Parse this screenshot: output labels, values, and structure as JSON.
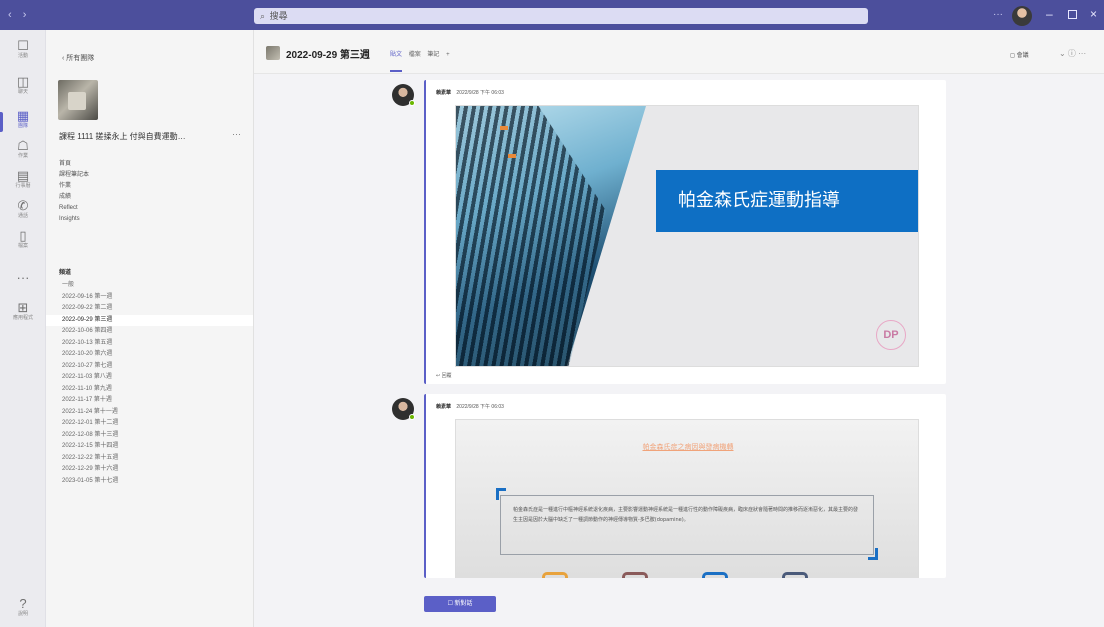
{
  "titlebar": {
    "search_placeholder": "搜尋",
    "nav_arrows": "‹ ›",
    "more": "···",
    "minimize": "–",
    "close": "×"
  },
  "rail": {
    "items": [
      {
        "label": "活動",
        "icon": "bell-icon",
        "glyph": "☐"
      },
      {
        "label": "聊天",
        "icon": "chat-icon",
        "glyph": "◫"
      },
      {
        "label": "團隊",
        "icon": "teams-icon",
        "glyph": "▦"
      },
      {
        "label": "作業",
        "icon": "assignments-icon",
        "glyph": "☖"
      },
      {
        "label": "行事曆",
        "icon": "calendar-icon",
        "glyph": "▤"
      },
      {
        "label": "通話",
        "icon": "phone-icon",
        "glyph": "✆"
      },
      {
        "label": "檔案",
        "icon": "files-icon",
        "glyph": "▯"
      },
      {
        "label": "",
        "icon": "more-apps-icon",
        "glyph": "···"
      },
      {
        "label": "應用程式",
        "icon": "apps-icon",
        "glyph": "⊞"
      },
      {
        "label": "說明",
        "icon": "help-icon",
        "glyph": "?"
      }
    ]
  },
  "team": {
    "back_label": "‹ 所有團隊",
    "name": "課程 1111 搓揉永上 付與自費運動…",
    "more": "···",
    "tabs": [
      "首頁",
      "課程筆記本",
      "作業",
      "成績",
      "Reflect",
      "Insights"
    ],
    "channels_title": "頻道",
    "channels": [
      "一般",
      "2022-09-16 第一週",
      "2022-09-22 第二週",
      "2022-09-29 第三週",
      "2022-10-06 第四週",
      "2022-10-13 第五週",
      "2022-10-20 第六週",
      "2022-10-27 第七週",
      "2022-11-03 第八週",
      "2022-11-10 第九週",
      "2022-11-17 第十週",
      "2022-11-24 第十一週",
      "2022-12-01 第十二週",
      "2022-12-08 第十三週",
      "2022-12-15 第十四週",
      "2022-12-22 第十五週",
      "2022-12-29 第十六週",
      "2023-01-05 第十七週"
    ],
    "selected_channel_index": 3
  },
  "channel": {
    "title": "2022-09-29 第三週",
    "tabs": [
      "貼文",
      "檔案",
      "筆記",
      "+"
    ],
    "active_tab": 0,
    "meet_label": "◻ 會議",
    "header_more": "⌄ ⓘ ···"
  },
  "messages": [
    {
      "author": "賴素華",
      "time": "2022/9/28 下午 06:03",
      "slide_title": "帕金森氏症運動指導",
      "slide_logo": "DP",
      "footer": "↩ 回覆"
    },
    {
      "author": "賴素華",
      "time": "2022/9/28 下午 06:03",
      "slide_title": "帕金森氏症之病因與發病機轉",
      "slide_body": "帕金森氏症是一種進行中樞神經系統退化疾病，主要影響運動神經系統是一種進行性的動作障礙疾病，臨床症狀會隨著時間的推移而逐漸惡化，其最主要的發生主因是因於大腦中缺乏了一種調節動作的神經傳導物質-多巴胺(dopamine)。"
    }
  ],
  "composer": {
    "new_post_label": "☐ 新對話"
  },
  "colors": {
    "brand": "#5b5fc7",
    "titlebar": "#4c4f9c",
    "slide_banner": "#0e6fc4"
  }
}
